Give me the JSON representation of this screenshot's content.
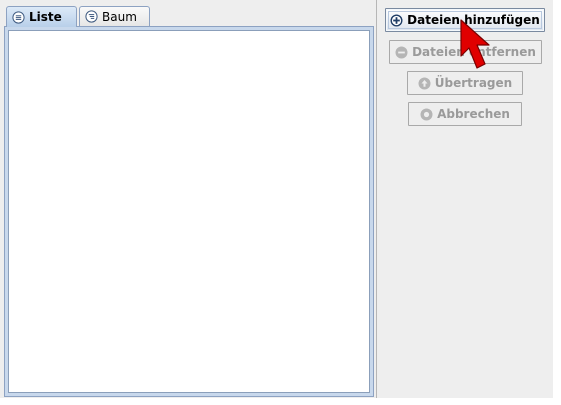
{
  "tabs": [
    {
      "label": "Liste",
      "icon": "list-icon",
      "active": true
    },
    {
      "label": "Baum",
      "icon": "tree-icon",
      "active": false
    }
  ],
  "buttons": {
    "add": {
      "label": "Dateien hinzufügen",
      "icon": "plus-circle-icon",
      "enabled": true
    },
    "remove": {
      "label": "Dateien entfernen",
      "icon": "minus-circle-icon",
      "enabled": false
    },
    "transfer": {
      "label": "Übertragen",
      "icon": "arrow-up-circle-icon",
      "enabled": false
    },
    "cancel": {
      "label": "Abbrechen",
      "icon": "stop-circle-icon",
      "enabled": false
    }
  },
  "colors": {
    "panel_background": "#eeeeee",
    "tab_active": "#b8cfe9",
    "disabled_text": "#9a9a9a",
    "cursor": "#e00000"
  }
}
